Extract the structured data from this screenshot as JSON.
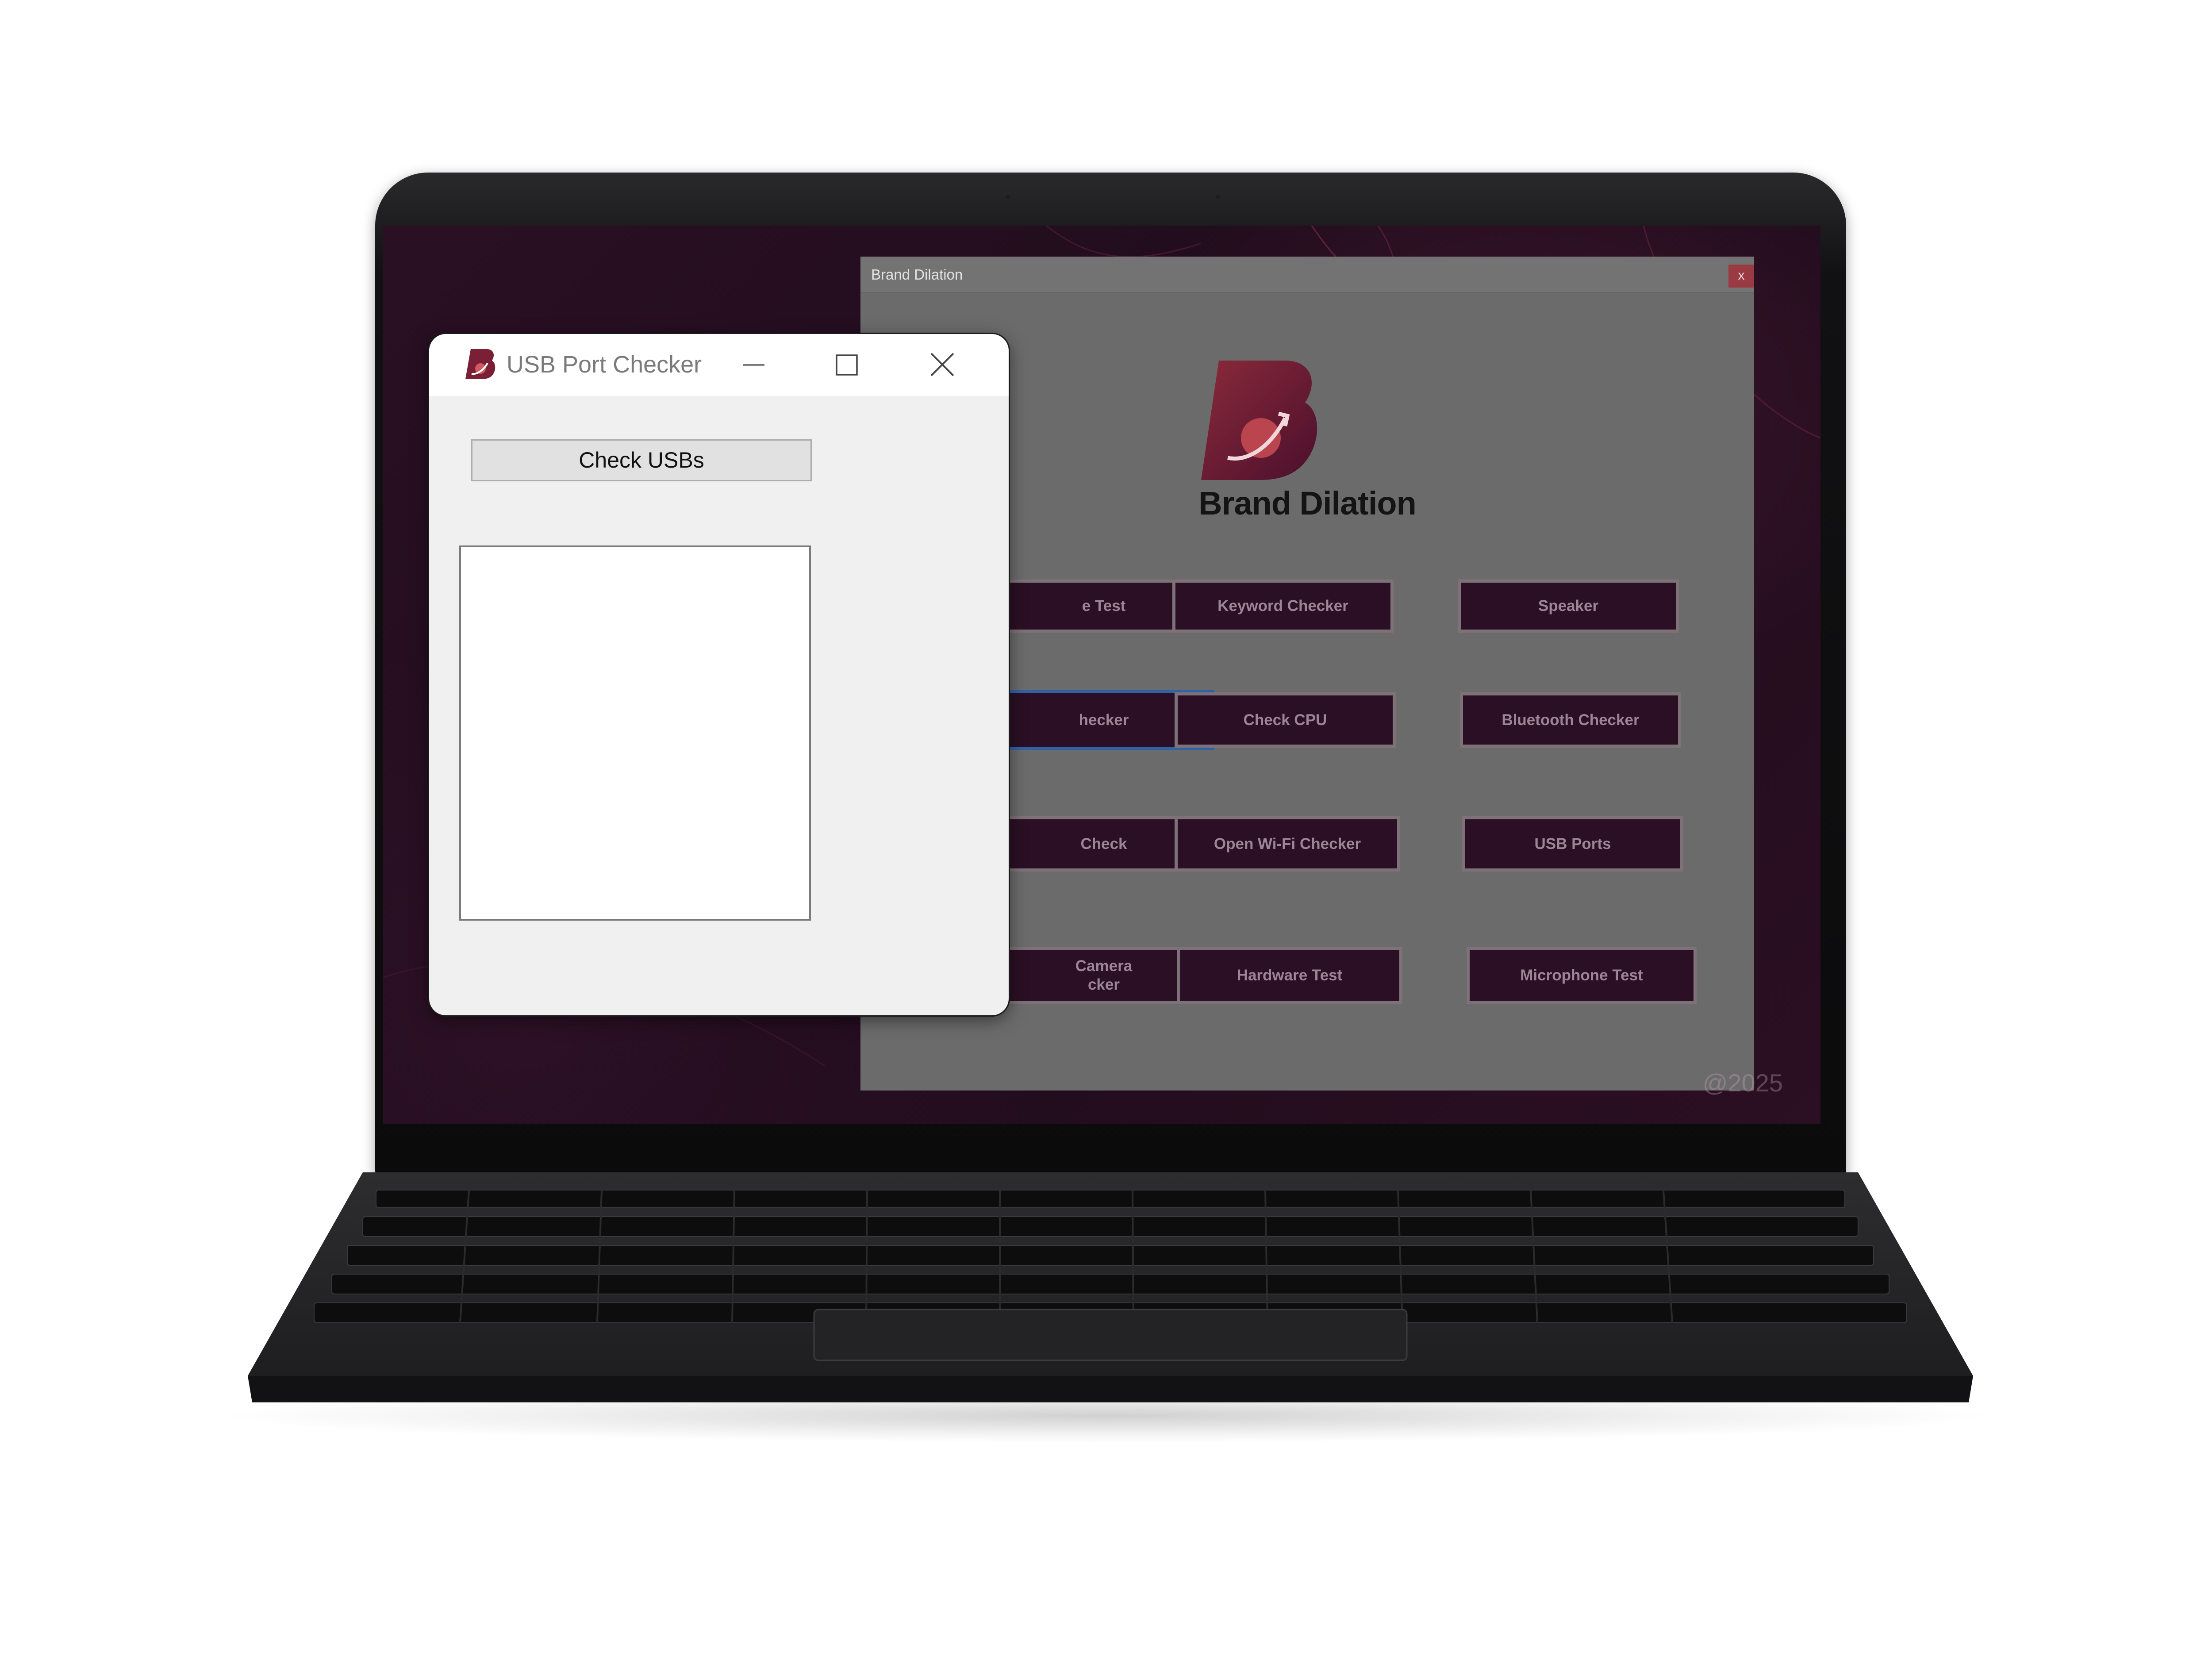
{
  "background_app": {
    "title": "Brand Dilation",
    "close_label": "x",
    "brand_name": "Brand Dilation",
    "watermark": "@2025",
    "buttons": [
      {
        "label": "e Test"
      },
      {
        "label": "Keyword Checker"
      },
      {
        "label": "Speaker"
      },
      {
        "label": "hecker"
      },
      {
        "label": "Check CPU"
      },
      {
        "label": "Bluetooth Checker"
      },
      {
        "label": "Check"
      },
      {
        "label": "Open Wi-Fi Checker"
      },
      {
        "label": "USB Ports"
      },
      {
        "label": "Camera\ncker"
      },
      {
        "label": "Hardware Test"
      },
      {
        "label": "Microphone Test"
      }
    ],
    "colors": {
      "button_bg": "#2b0f24",
      "button_text": "#9d8597",
      "selected_border": "#2f63a8"
    }
  },
  "usb_window": {
    "title": "USB Port Checker",
    "check_button_label": "Check USBs",
    "list_items": []
  },
  "icons": {
    "app_icon": "brand-b-logo-icon",
    "minimize": "minimize-icon",
    "maximize": "maximize-icon",
    "close": "close-icon"
  }
}
